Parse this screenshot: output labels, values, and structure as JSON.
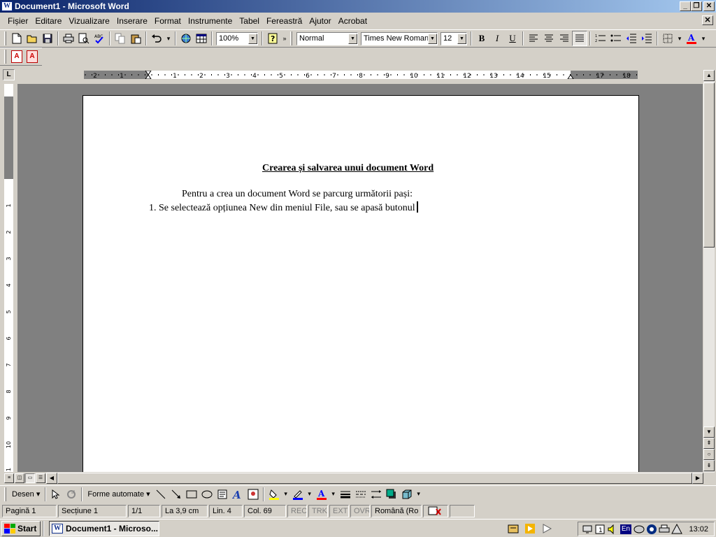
{
  "window": {
    "title": "Document1 - Microsoft Word",
    "app_icon": "W",
    "minimize": "_",
    "maximize": "❐",
    "close": "✕"
  },
  "menu": [
    "Fișier",
    "Editare",
    "Vizualizare",
    "Inserare",
    "Format",
    "Instrumente",
    "Tabel",
    "Fereastră",
    "Ajutor",
    "Acrobat"
  ],
  "toolbar_standard": {
    "zoom": "100%"
  },
  "toolbar_formatting": {
    "style": "Normal",
    "font": "Times New Roman",
    "size": "12",
    "bold": "B",
    "italic": "I",
    "underline": "U",
    "font_color_glyph": "A"
  },
  "ruler": {
    "corner": "L",
    "labels": [
      "2",
      "1",
      "1",
      "2",
      "3",
      "4",
      "5",
      "6",
      "7",
      "8",
      "9",
      "10",
      "11",
      "12",
      "13",
      "14",
      "15",
      "17",
      "18"
    ],
    "vlabels": [
      "2",
      "1",
      "1",
      "2",
      "3",
      "4",
      "5",
      "6",
      "7",
      "8",
      "9",
      "10",
      "11"
    ]
  },
  "document": {
    "title": "Crearea și salvarea unui document Word",
    "paragraph1": "Pentru a crea un document Word se parcurg următorii pași:",
    "item1": "1. Se selectează opțiunea New din meniul File, sau se apasă butonul"
  },
  "drawing_toolbar": {
    "draw": "Desen",
    "autoshapes": "Forme automate",
    "font_color_glyph": "A"
  },
  "status": {
    "page": "Pagină  1",
    "section": "Secțiune  1",
    "pages": "1/1",
    "at": "La  3,9 cm",
    "line": "Lin.  4",
    "col": "Col.  69",
    "rec": "REC",
    "trk": "TRK",
    "ext": "EXT",
    "ovr": "OVR",
    "language": "Română (Ro"
  },
  "taskbar": {
    "start": "Start",
    "task": "Document1 - Microso...",
    "tray_lang": "En",
    "clock": "13:02"
  },
  "colors": {
    "title_start": "#0a246a",
    "title_end": "#a6caf0",
    "face": "#d4d0c8",
    "workspace": "#808080"
  }
}
